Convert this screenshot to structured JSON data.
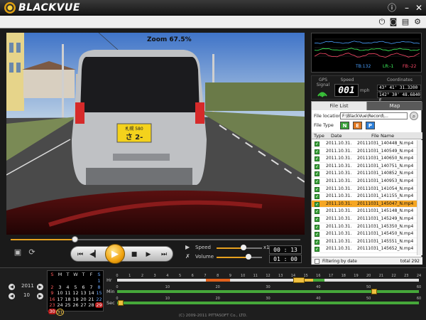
{
  "app": {
    "title": "BLACKVUE"
  },
  "titlebar": {
    "info_icon": "info-icon",
    "close_icon": "close-icon"
  },
  "toolbar": {
    "icons": [
      "power-icon",
      "camera-icon",
      "printer-icon",
      "gear-icon"
    ]
  },
  "video": {
    "zoom_label": "Zoom 67.5%",
    "plate_top": "札幌 580",
    "plate_main": "さ 2-    "
  },
  "player": {
    "speed_label": "Speed",
    "speed_value": "x1.0",
    "speed_level": 0.6,
    "volume_label": "Volume",
    "volume_level": 0.7,
    "progress": 0.22,
    "elapsed": "00 : 13",
    "duration": "01 : 00"
  },
  "graph": {
    "legend": [
      "TB:132",
      "LR:-1",
      "FB:-22"
    ],
    "colors": [
      "#4aa0ff",
      "#40ff60",
      "#ff4a6a"
    ]
  },
  "gps": {
    "signal_label": "GPS Signal",
    "speed_label": "Speed",
    "speed_value": "001",
    "speed_unit": "mph",
    "coords_label": "Coordinates",
    "lat": "43° 41' 31.3200 N",
    "lon": "142° 30' 48.6840 E"
  },
  "files": {
    "tabs": [
      "File List",
      "Map"
    ],
    "location_label": "File location",
    "location_value": "F:\\BlackVue\\Record\\...",
    "type_label": "File Type",
    "type_buttons": [
      {
        "label": "N",
        "color": "#3aa13a"
      },
      {
        "label": "E",
        "color": "#e0771f"
      },
      {
        "label": "P",
        "color": "#2d7fd8"
      }
    ],
    "headers": {
      "type": "Type",
      "date": "Date",
      "name": "File Name"
    },
    "rows": [
      {
        "date": "2011.10.31.",
        "name": "20111031_140448_N.mp4"
      },
      {
        "date": "2011.10.31.",
        "name": "20111031_140549_N.mp4"
      },
      {
        "date": "2011.10.31.",
        "name": "20111031_140650_N.mp4"
      },
      {
        "date": "2011.10.31.",
        "name": "20111031_140751_N.mp4"
      },
      {
        "date": "2011.10.31.",
        "name": "20111031_140852_N.mp4"
      },
      {
        "date": "2011.10.31.",
        "name": "20111031_140953_N.mp4"
      },
      {
        "date": "2011.10.31.",
        "name": "20111031_141054_N.mp4"
      },
      {
        "date": "2011.10.31.",
        "name": "20111031_141155_N.mp4"
      },
      {
        "date": "2011.10.31.",
        "name": "20111031_145047_N.mp4"
      },
      {
        "date": "2011.10.31.",
        "name": "20111031_145148_N.mp4"
      },
      {
        "date": "2011.10.31.",
        "name": "20111031_145249_N.mp4"
      },
      {
        "date": "2011.10.31.",
        "name": "20111031_145350_N.mp4"
      },
      {
        "date": "2011.10.31.",
        "name": "20111031_145450_N.mp4"
      },
      {
        "date": "2011.10.31.",
        "name": "20111031_145551_N.mp4"
      },
      {
        "date": "2011.10.31.",
        "name": "20111031_145652_N.mp4"
      }
    ],
    "selected_index": 8,
    "filter_label": "Filtering by date",
    "total": "total 292"
  },
  "calendar": {
    "year": "2011",
    "month": "10",
    "weekdays": [
      "S",
      "M",
      "T",
      "W",
      "T",
      "F",
      "S"
    ],
    "weeks": [
      [
        "",
        "",
        "",
        "",
        "",
        "",
        "1"
      ],
      [
        "2",
        "3",
        "4",
        "5",
        "6",
        "7",
        "8"
      ],
      [
        "9",
        "10",
        "11",
        "12",
        "13",
        "14",
        "15"
      ],
      [
        "16",
        "17",
        "18",
        "19",
        "20",
        "21",
        "22"
      ],
      [
        "23",
        "24",
        "25",
        "26",
        "27",
        "28",
        "29"
      ],
      [
        "30",
        "31",
        "",
        "",
        "",
        "",
        ""
      ]
    ],
    "highlighted": [
      "29",
      "30"
    ],
    "selected": "31"
  },
  "timeline": {
    "hr_label": "Hr",
    "min_label": "Min",
    "sec_label": "Sec",
    "hours": [
      "0",
      "1",
      "2",
      "3",
      "4",
      "5",
      "6",
      "7",
      "8",
      "9",
      "10",
      "11",
      "12",
      "13",
      "14",
      "15",
      "16",
      "17",
      "18",
      "19",
      "20",
      "21",
      "22",
      "23",
      "24"
    ],
    "minutes": [
      "0",
      "10",
      "20",
      "30",
      "40",
      "50",
      "60"
    ],
    "seconds": [
      "0",
      "10",
      "20",
      "30",
      "40",
      "50",
      "60"
    ]
  },
  "footer": {
    "copyright": "(C) 2009-2011 PITTASOFT Co., LTD."
  }
}
